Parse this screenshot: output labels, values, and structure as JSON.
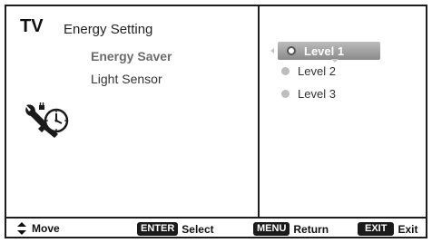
{
  "header": {
    "tv_label": "TV",
    "menu_title": "Energy Setting"
  },
  "menu": {
    "items": [
      {
        "label": "Energy Saver",
        "selected": true
      },
      {
        "label": "Light Sensor",
        "selected": false
      }
    ],
    "icon": "energy-clock-wrench-icon"
  },
  "options": {
    "items": [
      {
        "label": "Level 1",
        "selected": true
      },
      {
        "label": "Level 2",
        "selected": false
      },
      {
        "label": "Level 3",
        "selected": false
      }
    ]
  },
  "footer": {
    "move": {
      "icon": "up-down-arrows-icon",
      "label": "Move"
    },
    "enter": {
      "key": "ENTER",
      "label": "Select"
    },
    "menu": {
      "key": "MENU",
      "label": "Return"
    },
    "exit": {
      "key": "EXIT",
      "label": "Exit"
    }
  },
  "colors": {
    "border": "#1e1e1e",
    "highlight": "#9a9a9a",
    "key_bg": "#1a1a1a"
  }
}
